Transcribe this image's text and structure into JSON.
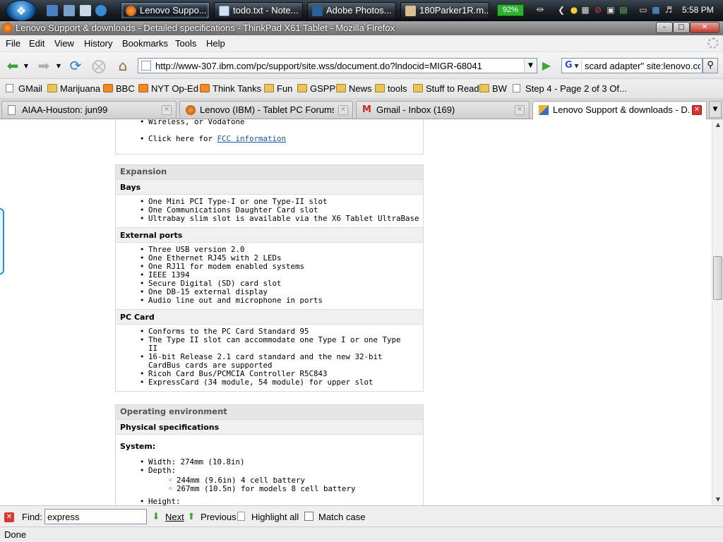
{
  "taskbar": {
    "tasks": [
      {
        "label": "Lenovo Suppo...",
        "icon": "firefox-icon"
      },
      {
        "label": "todo.txt - Note...",
        "icon": "notepad-icon"
      },
      {
        "label": "Adobe Photos...",
        "icon": "photoshop-icon"
      },
      {
        "label": "180Parker1R.m...",
        "icon": "media-icon"
      }
    ],
    "battery": "92%",
    "clock": "5:58 PM"
  },
  "window": {
    "title": "Lenovo Support & downloads - Detailed specifications - ThinkPad X61 Tablet - Mozilla Firefox"
  },
  "menu": [
    "File",
    "Edit",
    "View",
    "History",
    "Bookmarks",
    "Tools",
    "Help"
  ],
  "navbar": {
    "url": "http://www-307.ibm.com/pc/support/site.wss/document.do?lndocid=MIGR-68041",
    "search_value": "scard adapter\" site:lenovo.com",
    "search_engine": "G"
  },
  "bookmarks": [
    {
      "label": "GMail",
      "type": "page"
    },
    {
      "label": "Marijuana",
      "type": "folder"
    },
    {
      "label": "BBC",
      "type": "rss"
    },
    {
      "label": "NYT Op-Ed",
      "type": "rss"
    },
    {
      "label": "Think Tanks",
      "type": "rss"
    },
    {
      "label": "Fun",
      "type": "folder"
    },
    {
      "label": "GSPP",
      "type": "folder"
    },
    {
      "label": "News",
      "type": "folder"
    },
    {
      "label": "tools",
      "type": "folder"
    },
    {
      "label": "Stuff to Read",
      "type": "folder"
    },
    {
      "label": "BW",
      "type": "folder"
    },
    {
      "label": "Step 4 - Page 2 of 3 Of...",
      "type": "page"
    }
  ],
  "tabs": [
    {
      "label": "AIAA-Houston: jun99",
      "icon": "page-icon",
      "active": false
    },
    {
      "label": "Lenovo (IBM) - Tablet PC Forums, ...",
      "icon": "forum-icon",
      "active": false
    },
    {
      "label": "Gmail - Inbox (169)",
      "icon": "gmail-icon",
      "active": false
    },
    {
      "label": "Lenovo Support & downloads - D...",
      "icon": "lenovo-icon",
      "active": true
    }
  ],
  "content": {
    "top_partial": "Wireless, or Vodafone",
    "fcc_prefix": "Click here for ",
    "fcc_link": "FCC information",
    "expansion": {
      "heading": "Expansion",
      "bays": {
        "heading": "Bays",
        "items": [
          "One Mini PCI Type-I or one Type-II slot",
          "One Communications Daughter Card slot",
          "Ultrabay slim slot is available via the X6 Tablet UltraBase"
        ]
      },
      "ports": {
        "heading": "External ports",
        "items": [
          "Three USB version 2.0",
          "One Ethernet RJ45 with 2 LEDs",
          "One RJ11 for modem enabled systems",
          "IEEE 1394",
          "Secure Digital (SD) card slot",
          "One DB-15 external display",
          "Audio line out and microphone in ports"
        ]
      },
      "pccard": {
        "heading": "PC Card",
        "items": [
          "Conforms to the PC Card Standard 95",
          "The Type II slot can accommodate one Type I or one Type II",
          "16-bit Release 2.1 card standard and the new 32-bit CardBus cards are supported",
          "Ricoh Card Bus/PCMCIA Controller R5C843",
          "ExpressCard (34 module, 54 module) for upper slot"
        ]
      }
    },
    "operating": {
      "heading": "Operating environment",
      "physical_heading": "Physical specifications",
      "system_label": "System:",
      "width": "Width: 274mm (10.8in)",
      "depth": "Depth:",
      "depth_items": [
        "244mm (9.6in) 4 cell battery",
        "267mm (10.5n) for models 8 cell battery"
      ],
      "height": "Height:"
    }
  },
  "findbar": {
    "label": "Find:",
    "value": "express",
    "next": "Next",
    "previous": "Previous",
    "highlight": "Highlight all",
    "match_case": "Match case"
  },
  "status": "Done"
}
